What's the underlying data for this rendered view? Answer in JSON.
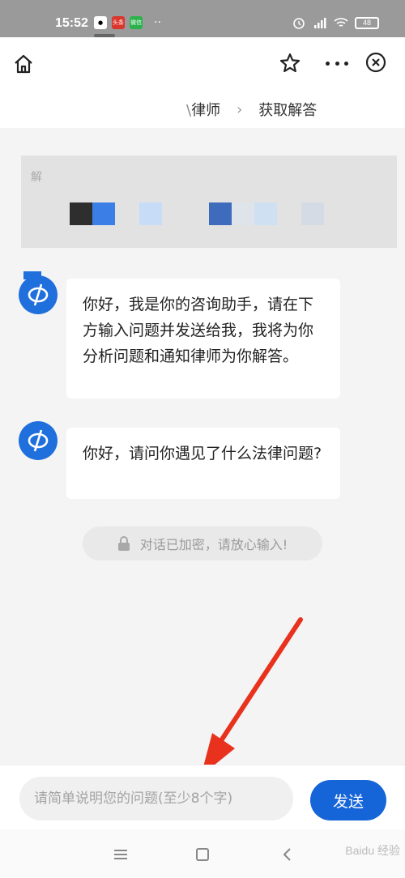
{
  "status_bar": {
    "time": "15:52",
    "battery": "48",
    "apps": [
      "头条",
      "微信"
    ],
    "more": "··"
  },
  "header": {
    "steps": [
      "律师",
      "获取解答"
    ],
    "step_prefix_fade": "\\"
  },
  "banner": {
    "partial_text": "解"
  },
  "chat": {
    "messages": [
      "你好，我是你的咨询助手，请在下方输入问题并发送给我，我将为你分析问题和通知律师为你解答。",
      "你好，请问你遇见了什么法律问题?"
    ],
    "secure_notice": "对话已加密，请放心输入!"
  },
  "input_bar": {
    "placeholder": "请简单说明您的问题(至少8个字)",
    "send_label": "发送"
  },
  "watermark": "Baidu 经验",
  "colors": {
    "accent": "#1565d8",
    "arrow": "#e8321e"
  },
  "icons": [
    "home-icon",
    "star-icon",
    "more-icon",
    "close-icon",
    "lock-icon",
    "menu-icon",
    "square-icon",
    "back-icon"
  ]
}
